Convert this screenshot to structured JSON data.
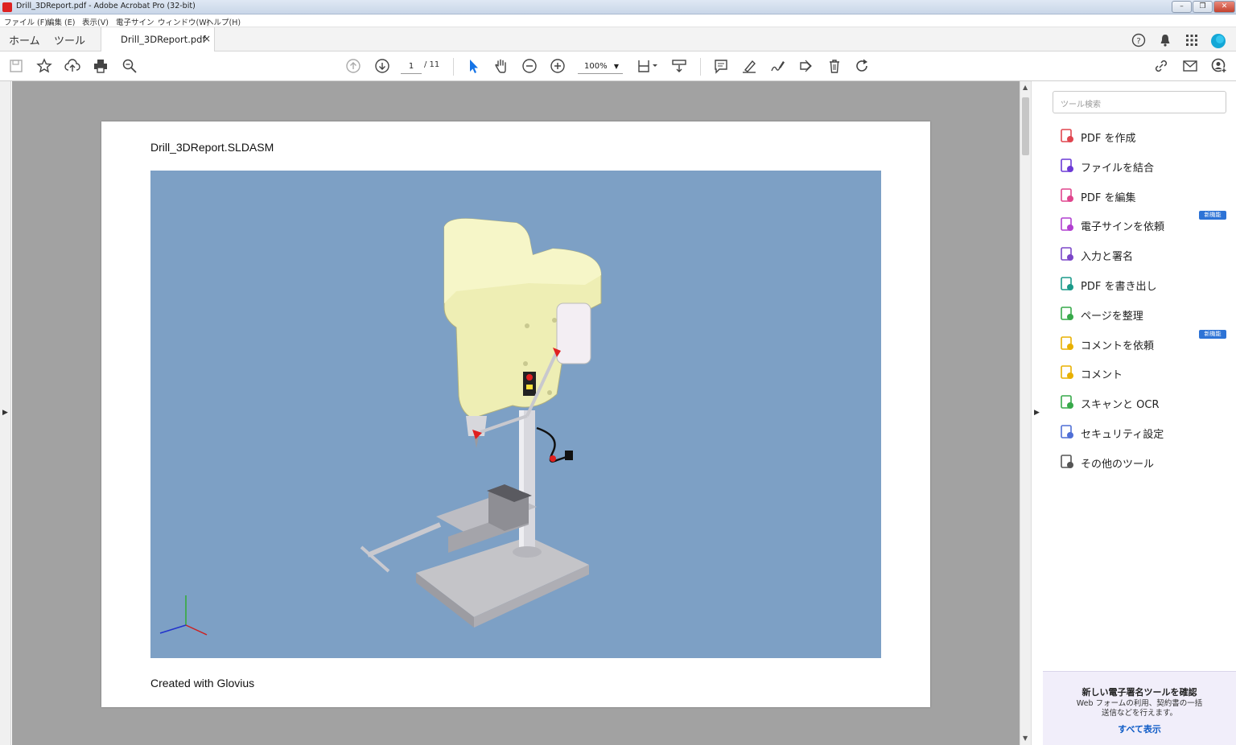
{
  "window": {
    "title": "Drill_3DReport.pdf - Adobe Acrobat Pro (32-bit)",
    "controls": [
      "–",
      "❐",
      "✕"
    ]
  },
  "menu": [
    "ファイル (F)",
    "編集 (E)",
    "表示(V)",
    "電子サイン",
    "ウィンドウ(W)",
    "ヘルプ(H)"
  ],
  "tabs": {
    "home": "ホーム",
    "tools": "ツール",
    "document": "Drill_3DReport.pdf",
    "close": "×"
  },
  "toolbar": {
    "page_current": "1",
    "page_total": "/ 11",
    "zoom": "100%"
  },
  "document": {
    "title": "Drill_3DReport.SLDASM",
    "footer": "Created with Glovius",
    "viewport_background": "#7da0c5"
  },
  "tools_pane": {
    "search_placeholder": "ツール検索",
    "items": [
      {
        "label": "PDF を作成",
        "icon": "create-pdf-icon",
        "color": "#e0454f"
      },
      {
        "label": "ファイルを結合",
        "icon": "combine-files-icon",
        "color": "#6c3ad6"
      },
      {
        "label": "PDF を編集",
        "icon": "edit-pdf-icon",
        "color": "#e0458d"
      },
      {
        "label": "電子サインを依頼",
        "icon": "request-signature-icon",
        "color": "#b13fd0",
        "badge": "新機能"
      },
      {
        "label": "入力と署名",
        "icon": "fill-sign-icon",
        "color": "#7b46c8"
      },
      {
        "label": "PDF を書き出し",
        "icon": "export-pdf-icon",
        "color": "#1b9a8a"
      },
      {
        "label": "ページを整理",
        "icon": "organize-pages-icon",
        "color": "#37a94a"
      },
      {
        "label": "コメントを依頼",
        "icon": "request-comments-icon",
        "color": "#e8b000",
        "badge": "新機能"
      },
      {
        "label": "コメント",
        "icon": "comment-icon",
        "color": "#e8b000"
      },
      {
        "label": "スキャンと OCR",
        "icon": "scan-ocr-icon",
        "color": "#37a94a"
      },
      {
        "label": "セキュリティ設定",
        "icon": "security-shield-icon",
        "color": "#4f6fd6"
      },
      {
        "label": "その他のツール",
        "icon": "more-tools-icon",
        "color": "#555555"
      }
    ],
    "promo": {
      "heading": "新しい電子署名ツールを確認",
      "body": "Web フォームの利用、契約書の一括送信などを行えます。",
      "link": "すべて表示"
    }
  },
  "colors": {
    "accent": "#1473e6",
    "canvas": "#a2a2a2",
    "promo_bg": "#f1eefa"
  }
}
